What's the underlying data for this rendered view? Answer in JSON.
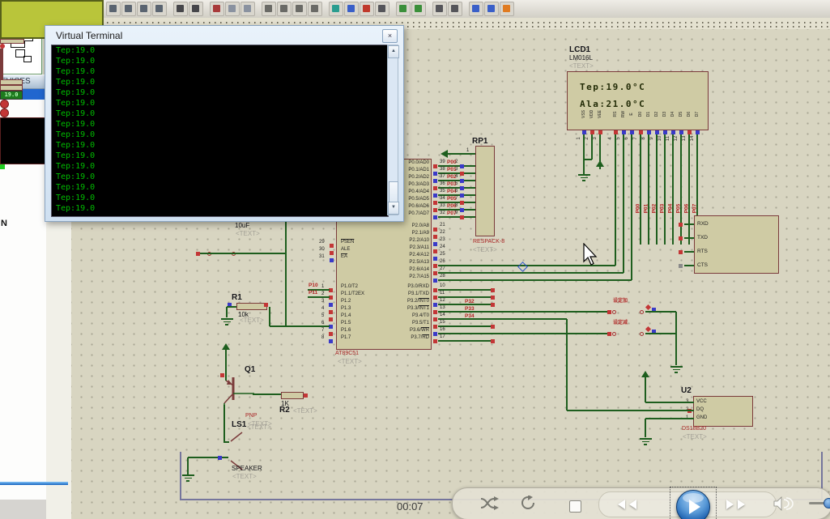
{
  "toolbar": {
    "icons": [
      {
        "name": "device-icon",
        "color": "#c2a878"
      },
      {
        "name": "save-icon",
        "color": "#9aa0a8"
      },
      {
        "name": "edit-check-icon",
        "color": "#4a7ad0"
      },
      {
        "name": "grid-icon",
        "color": "#8b97a5"
      },
      {
        "name": "origin-pin-icon",
        "color": "#3a7d3a"
      },
      {
        "name": "pan-icon",
        "color": "#3a5fc8"
      },
      {
        "name": "zoom-in-icon",
        "color": "#5a6470"
      },
      {
        "name": "zoom-out-icon",
        "color": "#5a6470"
      },
      {
        "name": "zoom-area-icon",
        "color": "#5a6470"
      },
      {
        "name": "zoom-all-icon",
        "color": "#5a6470"
      },
      {
        "name": "undo-icon",
        "color": "#46464a"
      },
      {
        "name": "redo-icon",
        "color": "#46464a"
      },
      {
        "name": "cut-icon",
        "color": "#a83a3a"
      },
      {
        "name": "copy-icon",
        "color": "#8a92a0"
      },
      {
        "name": "paste-icon",
        "color": "#8a92a0"
      },
      {
        "name": "block-copy-icon",
        "color": "#6a6a66"
      },
      {
        "name": "block-move-icon",
        "color": "#6a6a66"
      },
      {
        "name": "block-rotate-icon",
        "color": "#6a6a66"
      },
      {
        "name": "block-delete-icon",
        "color": "#6a6a66"
      },
      {
        "name": "pick-part-icon",
        "color": "#2a9d8f"
      },
      {
        "name": "make-device-icon",
        "color": "#3a5fc8"
      },
      {
        "name": "packaging-icon",
        "color": "#c0392b"
      },
      {
        "name": "decompose-icon",
        "color": "#55555a"
      },
      {
        "name": "wire-autoroute-icon",
        "color": "#3a8f3a"
      },
      {
        "name": "search-tag-icon",
        "color": "#3a8f3a"
      },
      {
        "name": "property-tool-icon",
        "color": "#55555a"
      },
      {
        "name": "design-explorer-icon",
        "color": "#55555a"
      },
      {
        "name": "new-sheet-icon",
        "color": "#3a5fc8"
      },
      {
        "name": "remove-sheet-icon",
        "color": "#3a5fc8"
      },
      {
        "name": "bill-of-materials-icon",
        "color": "#e07b20"
      }
    ]
  },
  "sidebar": {
    "devices_label": "EVICES",
    "list_text": "N"
  },
  "terminal": {
    "title": "Virtual Terminal",
    "close_glyph": "×",
    "lines": [
      "Tep:19.0",
      "Tep:19.0",
      "Tep:19.0",
      "Tep:19.0",
      "Tep:19.0",
      "Tep:19.0",
      "Tep:19.0",
      "Tep:19.0",
      "Tep:19.0",
      "Tep:19.0",
      "Tep:19.0",
      "Tep:19.0",
      "Tep:19.0",
      "Tep:19.0",
      "Tep:19.0",
      "Tep:19.0"
    ]
  },
  "schematic": {
    "lcd": {
      "ref": "LCD1",
      "part": "LM016L",
      "placeholder": "<TEXT>",
      "line1": "Tep:19.0°C",
      "line2": "Ala:21.0°C",
      "pin_names": [
        "VSS",
        "VDD",
        "VEE",
        "RS",
        "RW",
        "E",
        "D0",
        "D1",
        "D2",
        "D3",
        "D4",
        "D5",
        "D6",
        "D7"
      ],
      "pin_numbers": [
        "1",
        "2",
        "3",
        "4",
        "5",
        "6",
        "7",
        "8",
        "9",
        "10",
        "11",
        "12",
        "13",
        "14"
      ],
      "net_labels": [
        "P00",
        "P01",
        "P02",
        "P03",
        "P04",
        "P05",
        "P06",
        "P07"
      ]
    },
    "rp": {
      "ref": "RP1",
      "part": "RESPACK-8",
      "placeholder": "<TEXT>",
      "pin1": "1"
    },
    "mcu": {
      "ref": "AT89C51",
      "placeholder": "<TEXT>",
      "ctrl": [
        {
          "num": "29",
          "label": "PSEN",
          "ov": "PSEN"
        },
        {
          "num": "30",
          "label": "ALE"
        },
        {
          "num": "31",
          "label": "EA",
          "ov": "EA"
        }
      ],
      "p1": [
        {
          "num": "1",
          "label": "P1.0/T2"
        },
        {
          "num": "2",
          "label": "P1.1/T2EX"
        },
        {
          "num": "3",
          "label": "P1.2"
        },
        {
          "num": "4",
          "label": "P1.3"
        },
        {
          "num": "5",
          "label": "P1.4"
        },
        {
          "num": "6",
          "label": "P1.5"
        },
        {
          "num": "7",
          "label": "P1.6"
        },
        {
          "num": "8",
          "label": "P1.7"
        }
      ],
      "p0": [
        {
          "num": "39",
          "label": "P0.0/AD0",
          "net": "P00",
          "rp": "2"
        },
        {
          "num": "38",
          "label": "P0.1/AD1",
          "net": "P01",
          "rp": "3"
        },
        {
          "num": "37",
          "label": "P0.2/AD2",
          "net": "P02",
          "rp": "4"
        },
        {
          "num": "36",
          "label": "P0.3/AD3",
          "net": "P03",
          "rp": "5"
        },
        {
          "num": "35",
          "label": "P0.4/AD4",
          "net": "P04",
          "rp": "6"
        },
        {
          "num": "34",
          "label": "P0.5/AD5",
          "net": "P05",
          "rp": "7"
        },
        {
          "num": "33",
          "label": "P0.6/AD6",
          "net": "P06",
          "rp": "8"
        },
        {
          "num": "32",
          "label": "P0.7/AD7",
          "net": "P07",
          "rp": "9"
        }
      ],
      "p2": [
        {
          "num": "21",
          "label": "P2.0/A8"
        },
        {
          "num": "22",
          "label": "P2.1/A9"
        },
        {
          "num": "23",
          "label": "P2.2/A10"
        },
        {
          "num": "24",
          "label": "P2.3/A11"
        },
        {
          "num": "25",
          "label": "P2.4/A12"
        },
        {
          "num": "26",
          "label": "P2.5/A13"
        },
        {
          "num": "27",
          "label": "P2.6/A14"
        },
        {
          "num": "28",
          "label": "P2.7/A15"
        }
      ],
      "p3": [
        {
          "num": "10",
          "label": "P3.0/RXD"
        },
        {
          "num": "11",
          "label": "P3.1/TXD"
        },
        {
          "num": "12",
          "label": "P3.2/INT0",
          "ov": "INT0"
        },
        {
          "num": "13",
          "label": "P3.3/INT1",
          "ov": "INT1"
        },
        {
          "num": "14",
          "label": "P3.4/T0"
        },
        {
          "num": "15",
          "label": "P3.5/T1"
        },
        {
          "num": "16",
          "label": "P3.6/WR",
          "ov": "WR"
        },
        {
          "num": "17",
          "label": "P3.7/RD",
          "ov": "RD"
        }
      ],
      "left_nets": [
        "P10",
        "P11"
      ],
      "right_nets": [
        "P32",
        "P33",
        "P34"
      ]
    },
    "reset": {
      "cap": "10uF",
      "placeholder": "<TEXT>"
    },
    "r1": {
      "ref": "R1",
      "value": "10k",
      "placeholder": "<TEXT>"
    },
    "r2": {
      "ref": "R2",
      "value": "1K",
      "placeholder": "<TEXT>"
    },
    "q1": {
      "ref": "Q1",
      "value": "PNP",
      "placeholder": "<TEXT>"
    },
    "ls1": {
      "ref": "LS1",
      "value": "SPEAKER",
      "placeholder": "<TEXT>"
    },
    "u2": {
      "ref": "U2",
      "part": "DS18B20",
      "placeholder": "<TEXT>",
      "display": "19.0",
      "pins": [
        {
          "num": "3",
          "name": "VCC"
        },
        {
          "num": "2",
          "name": "DQ"
        },
        {
          "num": "1",
          "name": "GND"
        }
      ]
    },
    "serial_pins": [
      "RXD",
      "TXD",
      "RTS",
      "CTS"
    ],
    "buttons": [
      {
        "label": "设定加"
      },
      {
        "label": "设定减"
      }
    ]
  },
  "player": {
    "time": "00:07"
  },
  "colors": {
    "wire": "#1e5e1e",
    "outline": "#7b3b3b",
    "body": "#cfcba4",
    "lcd_screen": "#b9c53a",
    "terminal_green": "#00bb00",
    "net_label": "#b22222",
    "pin_red": "#c33636",
    "pin_blue": "#3a3ac8"
  }
}
